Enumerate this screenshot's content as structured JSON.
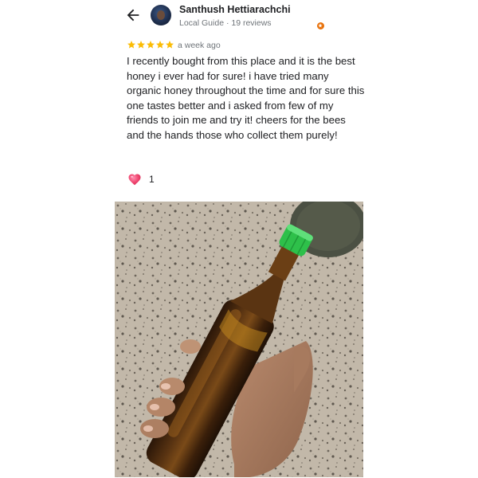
{
  "header": {
    "back_icon": "arrow-back-icon",
    "reviewer_name": "Santhush Hettiarachchi",
    "reviewer_meta": "Local Guide · 19 reviews",
    "badge_icon": "local-guide-star-icon"
  },
  "review": {
    "rating": 5,
    "star_color": "#fbbc04",
    "time": "a week ago",
    "text": "I recently bought from this place and it is the best honey i ever had for sure! i have tried many organic honey throughout the time and for sure this one tastes better and i asked from few of my friends to join me and try it! cheers for the bees and the hands those who collect them purely!"
  },
  "reactions": {
    "icon": "heart-icon",
    "like_count": "1"
  },
  "photo": {
    "subject": "honey-bottle-photo"
  }
}
